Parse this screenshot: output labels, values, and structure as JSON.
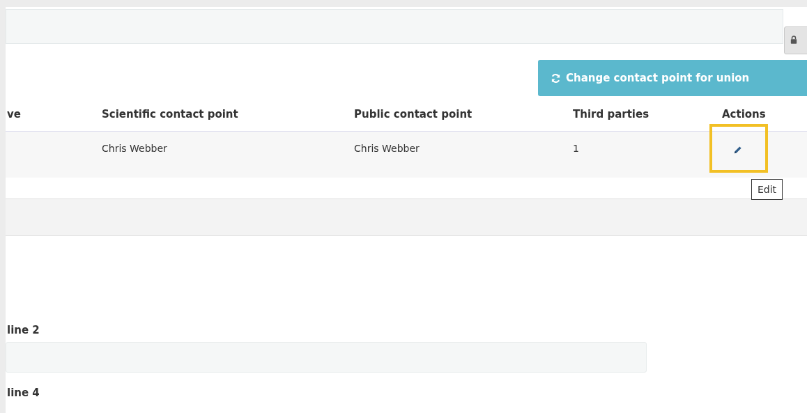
{
  "top_field": {
    "kind": "input"
  },
  "lock_button": {
    "kind": "lock"
  },
  "change_button": {
    "label": "Change contact point for union"
  },
  "table": {
    "columns": [
      "ve",
      "Scientific contact point",
      "Public contact point",
      "Third parties",
      "Actions"
    ],
    "rows": [
      {
        "cells": [
          "",
          "Chris Webber",
          "Chris Webber",
          "1"
        ],
        "actions": [
          {
            "kind": "edit",
            "highlighted": true,
            "tooltip": "Edit"
          }
        ]
      }
    ]
  },
  "form": [
    {
      "label": "line 2",
      "kind": "field"
    },
    {
      "label": "line 4",
      "kind": "label"
    }
  ]
}
